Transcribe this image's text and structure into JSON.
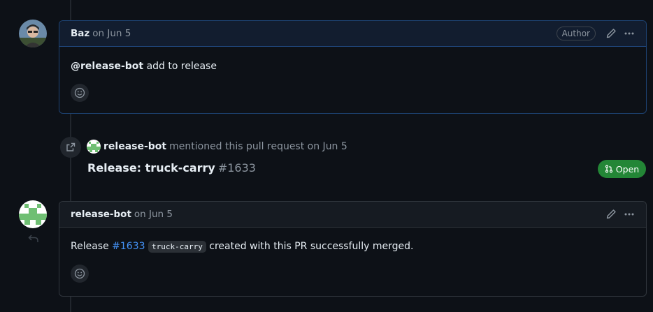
{
  "colors": {
    "background": "#0d1117",
    "author_border": "#388bfd",
    "link": "#4493f8",
    "open_badge": "#238636",
    "muted_text": "#8d96a0"
  },
  "comment1": {
    "user": "Baz",
    "date": "on Jun 5",
    "badge": "Author",
    "mention": "@release-bot",
    "body_text": " add to release",
    "icons": [
      "pencil-icon",
      "kebab-icon",
      "smiley-icon"
    ]
  },
  "event": {
    "icon": "cross-reference-icon",
    "user": "release-bot",
    "text": "mentioned this pull request on Jun 5",
    "pr_title": "Release: truck-carry",
    "pr_number": "#1633",
    "status": "Open",
    "status_icon": "git-pull-request-icon"
  },
  "comment2": {
    "user": "release-bot",
    "date": "on Jun 5",
    "body_prefix": "Release ",
    "link": "#1633",
    "code": "truck-carry",
    "body_suffix": " created with this PR successfully merged.",
    "icons": [
      "pencil-icon",
      "kebab-icon",
      "smiley-icon",
      "reply-icon"
    ]
  }
}
